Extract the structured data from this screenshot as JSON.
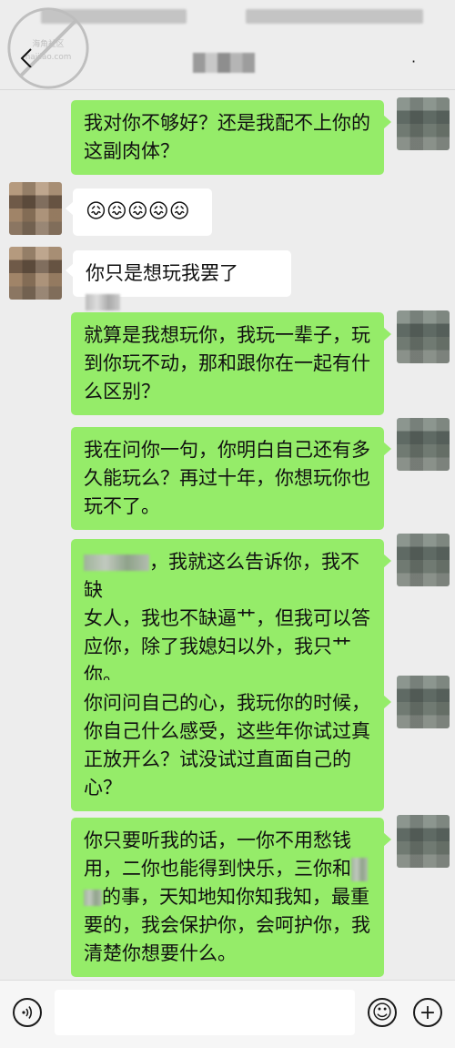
{
  "header": {
    "back_icon": "back-arrow-icon",
    "title_redacted": true,
    "more_label": "·",
    "watermark_text": "海角社区 haijiao.com"
  },
  "messages": [
    {
      "side": "right",
      "text_parts": [
        "我对你不够好？还是我配不上你的",
        "这副肉体？"
      ]
    },
    {
      "side": "left",
      "text": "😖😖😖😖😖"
    },
    {
      "side": "left",
      "text": "你只是想玩我罢了"
    },
    {
      "side": "right",
      "text_parts": [
        "就算是我想玩你，我玩一辈子，玩",
        "到你玩不动，那和跟你在一起有什",
        "么区别？"
      ]
    },
    {
      "side": "right",
      "text_parts": [
        "我在问你一句，你明白自己还有多",
        "久能玩么？再过十年，你想玩你也",
        "玩不了。"
      ]
    },
    {
      "side": "right",
      "text_parts": [
        "，我就这么告诉你，我不缺",
        "女人，我也不缺逼艹，但我可以答",
        "应你，除了我媳妇以外，我只艹",
        "你。"
      ]
    },
    {
      "side": "right",
      "text_parts": [
        "你问问自己的心，我玩你的时候，",
        "你自己什么感受，这些年你试过真",
        "正放开么？试没试过直面自己的",
        "心？"
      ]
    },
    {
      "side": "right",
      "text_parts": [
        "你只要听我的话，一你不用愁钱",
        "用，二你也能得到快乐，三你和",
        "的事，天知地知你知我知，最重",
        "要的，我会保护你，会呵护你，我",
        "清楚你想要什么。"
      ]
    }
  ],
  "input_bar": {
    "voice_icon": "voice-icon",
    "emoji_icon": "emoji-icon",
    "plus_icon": "plus-icon",
    "emoji_glyph": "☺",
    "plus_glyph": "+",
    "placeholder": ""
  },
  "colors": {
    "self_bubble": "#95ec69",
    "other_bubble": "#ffffff",
    "background": "#ededed"
  }
}
